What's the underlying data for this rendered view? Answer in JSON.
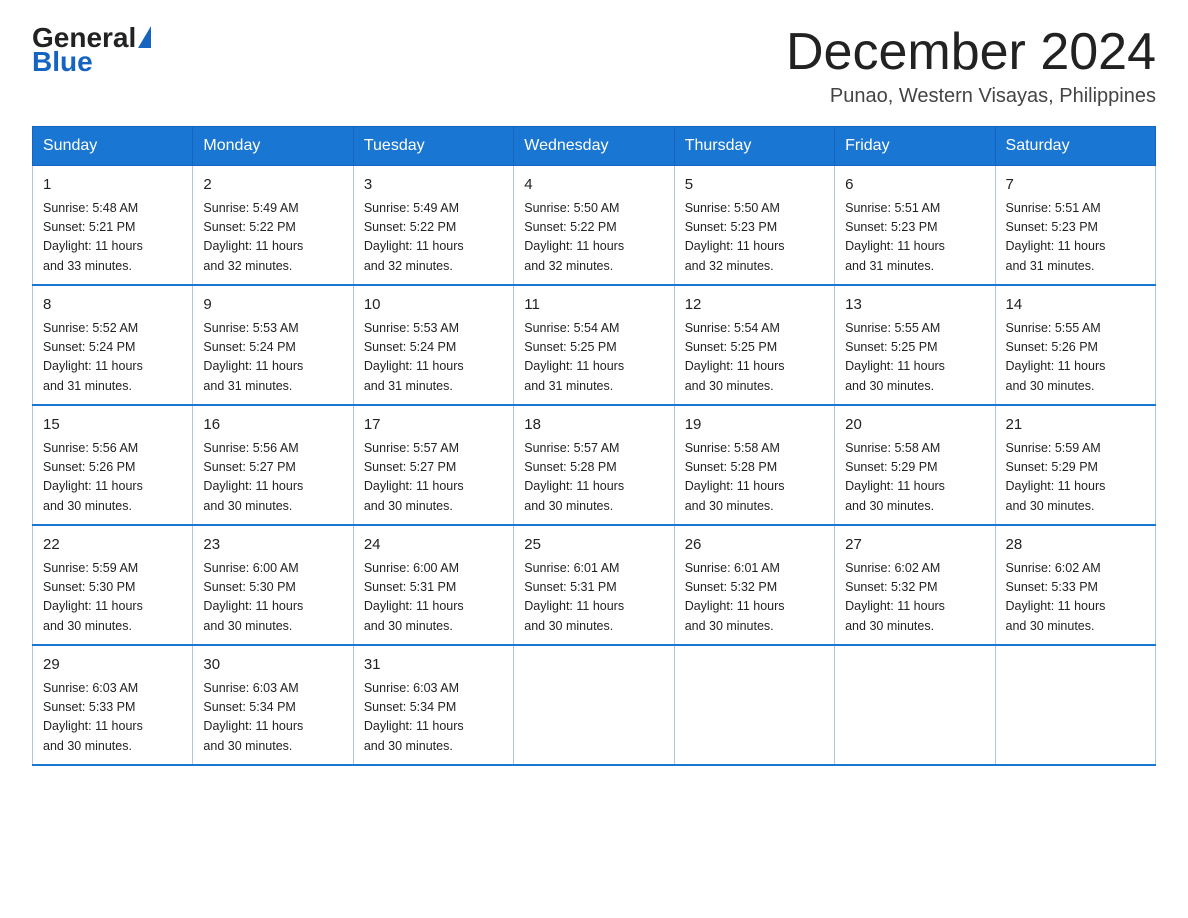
{
  "logo": {
    "general": "General",
    "blue": "Blue"
  },
  "title": "December 2024",
  "location": "Punao, Western Visayas, Philippines",
  "days_of_week": [
    "Sunday",
    "Monday",
    "Tuesday",
    "Wednesday",
    "Thursday",
    "Friday",
    "Saturday"
  ],
  "weeks": [
    [
      {
        "day": "1",
        "info": "Sunrise: 5:48 AM\nSunset: 5:21 PM\nDaylight: 11 hours\nand 33 minutes."
      },
      {
        "day": "2",
        "info": "Sunrise: 5:49 AM\nSunset: 5:22 PM\nDaylight: 11 hours\nand 32 minutes."
      },
      {
        "day": "3",
        "info": "Sunrise: 5:49 AM\nSunset: 5:22 PM\nDaylight: 11 hours\nand 32 minutes."
      },
      {
        "day": "4",
        "info": "Sunrise: 5:50 AM\nSunset: 5:22 PM\nDaylight: 11 hours\nand 32 minutes."
      },
      {
        "day": "5",
        "info": "Sunrise: 5:50 AM\nSunset: 5:23 PM\nDaylight: 11 hours\nand 32 minutes."
      },
      {
        "day": "6",
        "info": "Sunrise: 5:51 AM\nSunset: 5:23 PM\nDaylight: 11 hours\nand 31 minutes."
      },
      {
        "day": "7",
        "info": "Sunrise: 5:51 AM\nSunset: 5:23 PM\nDaylight: 11 hours\nand 31 minutes."
      }
    ],
    [
      {
        "day": "8",
        "info": "Sunrise: 5:52 AM\nSunset: 5:24 PM\nDaylight: 11 hours\nand 31 minutes."
      },
      {
        "day": "9",
        "info": "Sunrise: 5:53 AM\nSunset: 5:24 PM\nDaylight: 11 hours\nand 31 minutes."
      },
      {
        "day": "10",
        "info": "Sunrise: 5:53 AM\nSunset: 5:24 PM\nDaylight: 11 hours\nand 31 minutes."
      },
      {
        "day": "11",
        "info": "Sunrise: 5:54 AM\nSunset: 5:25 PM\nDaylight: 11 hours\nand 31 minutes."
      },
      {
        "day": "12",
        "info": "Sunrise: 5:54 AM\nSunset: 5:25 PM\nDaylight: 11 hours\nand 30 minutes."
      },
      {
        "day": "13",
        "info": "Sunrise: 5:55 AM\nSunset: 5:25 PM\nDaylight: 11 hours\nand 30 minutes."
      },
      {
        "day": "14",
        "info": "Sunrise: 5:55 AM\nSunset: 5:26 PM\nDaylight: 11 hours\nand 30 minutes."
      }
    ],
    [
      {
        "day": "15",
        "info": "Sunrise: 5:56 AM\nSunset: 5:26 PM\nDaylight: 11 hours\nand 30 minutes."
      },
      {
        "day": "16",
        "info": "Sunrise: 5:56 AM\nSunset: 5:27 PM\nDaylight: 11 hours\nand 30 minutes."
      },
      {
        "day": "17",
        "info": "Sunrise: 5:57 AM\nSunset: 5:27 PM\nDaylight: 11 hours\nand 30 minutes."
      },
      {
        "day": "18",
        "info": "Sunrise: 5:57 AM\nSunset: 5:28 PM\nDaylight: 11 hours\nand 30 minutes."
      },
      {
        "day": "19",
        "info": "Sunrise: 5:58 AM\nSunset: 5:28 PM\nDaylight: 11 hours\nand 30 minutes."
      },
      {
        "day": "20",
        "info": "Sunrise: 5:58 AM\nSunset: 5:29 PM\nDaylight: 11 hours\nand 30 minutes."
      },
      {
        "day": "21",
        "info": "Sunrise: 5:59 AM\nSunset: 5:29 PM\nDaylight: 11 hours\nand 30 minutes."
      }
    ],
    [
      {
        "day": "22",
        "info": "Sunrise: 5:59 AM\nSunset: 5:30 PM\nDaylight: 11 hours\nand 30 minutes."
      },
      {
        "day": "23",
        "info": "Sunrise: 6:00 AM\nSunset: 5:30 PM\nDaylight: 11 hours\nand 30 minutes."
      },
      {
        "day": "24",
        "info": "Sunrise: 6:00 AM\nSunset: 5:31 PM\nDaylight: 11 hours\nand 30 minutes."
      },
      {
        "day": "25",
        "info": "Sunrise: 6:01 AM\nSunset: 5:31 PM\nDaylight: 11 hours\nand 30 minutes."
      },
      {
        "day": "26",
        "info": "Sunrise: 6:01 AM\nSunset: 5:32 PM\nDaylight: 11 hours\nand 30 minutes."
      },
      {
        "day": "27",
        "info": "Sunrise: 6:02 AM\nSunset: 5:32 PM\nDaylight: 11 hours\nand 30 minutes."
      },
      {
        "day": "28",
        "info": "Sunrise: 6:02 AM\nSunset: 5:33 PM\nDaylight: 11 hours\nand 30 minutes."
      }
    ],
    [
      {
        "day": "29",
        "info": "Sunrise: 6:03 AM\nSunset: 5:33 PM\nDaylight: 11 hours\nand 30 minutes."
      },
      {
        "day": "30",
        "info": "Sunrise: 6:03 AM\nSunset: 5:34 PM\nDaylight: 11 hours\nand 30 minutes."
      },
      {
        "day": "31",
        "info": "Sunrise: 6:03 AM\nSunset: 5:34 PM\nDaylight: 11 hours\nand 30 minutes."
      },
      {
        "day": "",
        "info": ""
      },
      {
        "day": "",
        "info": ""
      },
      {
        "day": "",
        "info": ""
      },
      {
        "day": "",
        "info": ""
      }
    ]
  ]
}
